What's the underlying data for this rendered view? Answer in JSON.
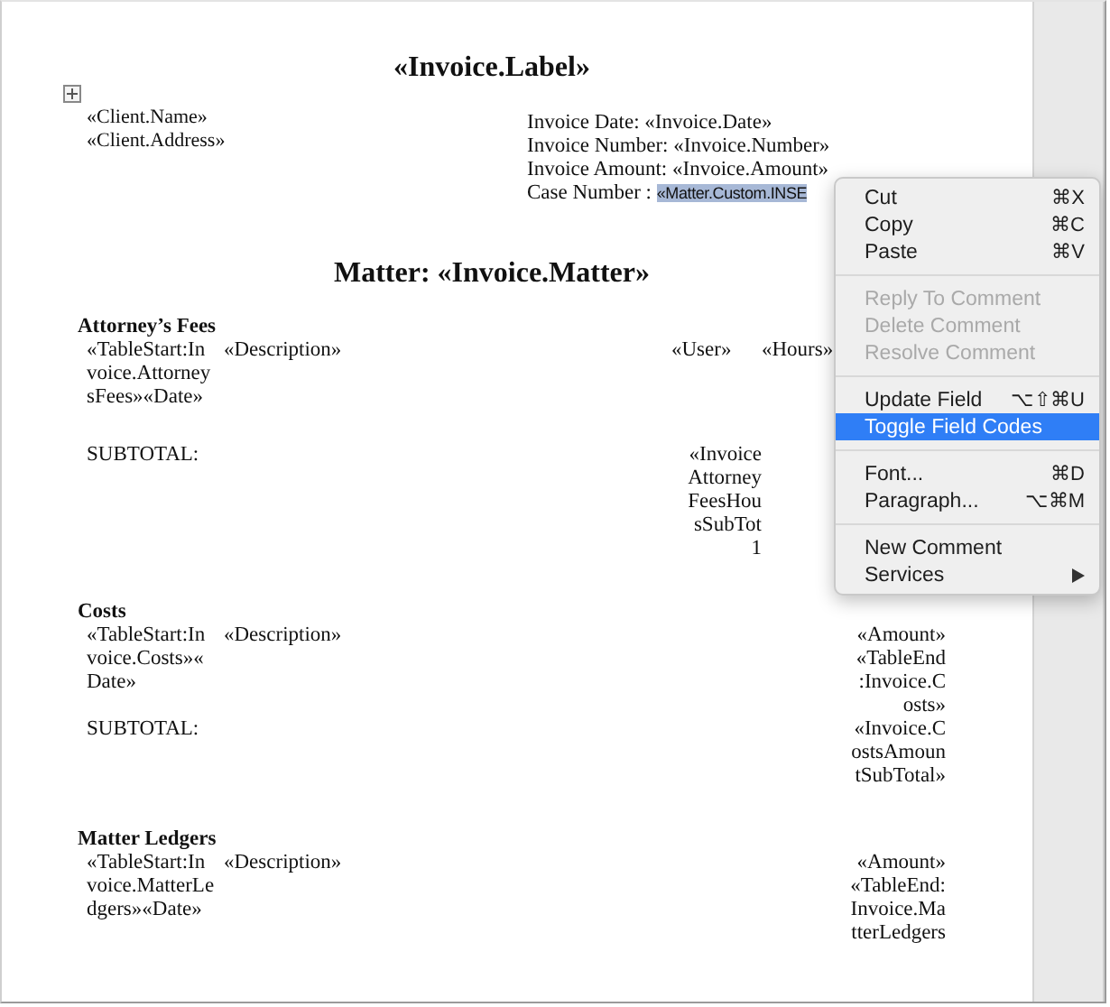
{
  "document": {
    "title": "«Invoice.Label»",
    "client": [
      "«Client.Name»",
      "«Client.Address»"
    ],
    "invoice_info": [
      {
        "label": "Invoice Date: ",
        "value": "«Invoice.Date»",
        "selected": false
      },
      {
        "label": "Invoice Number: ",
        "value": "«Invoice.Number»",
        "selected": false
      },
      {
        "label": "Invoice Amount: ",
        "value": "«Invoice.Amount»",
        "selected": false
      },
      {
        "label": "Case Number : ",
        "value": "«Matter.Custom.INSE",
        "selected": true
      }
    ],
    "matter_heading": "Matter: «Invoice.Matter»",
    "sections": [
      {
        "heading": "Attorney’s Fees",
        "rows": [
          {
            "kind": "entry",
            "date": [
              "«TableStart:In",
              "voice.Attorney",
              "sFees»«Date»"
            ],
            "description": "«Description»",
            "user": "«User»",
            "hours": "«Hours»"
          },
          {
            "kind": "subtotal_mid",
            "label": "SUBTOTAL:",
            "amount": [
              "«Invoice",
              "Attorney",
              "FeesHou",
              "sSubTot",
              "1"
            ]
          }
        ]
      },
      {
        "heading": "Costs",
        "rows": [
          {
            "kind": "entry",
            "date": [
              "«TableStart:In",
              "voice.Costs»«",
              "Date»"
            ],
            "description": "«Description»",
            "amount": [
              "«Amount»",
              "«TableEnd",
              ":Invoice.C",
              "osts»"
            ]
          },
          {
            "kind": "subtotal",
            "label": "SUBTOTAL:",
            "amount": [
              "«Invoice.C",
              "ostsAmoun",
              "tSubTotal»"
            ]
          }
        ]
      },
      {
        "heading": "Matter Ledgers",
        "rows": [
          {
            "kind": "entry",
            "date": [
              "«TableStart:In",
              "voice.MatterLe",
              "dgers»«Date»"
            ],
            "description": "«Description»",
            "amount": [
              "«Amount»",
              "«TableEnd:",
              "Invoice.Ma",
              "tterLedgers"
            ]
          }
        ]
      }
    ]
  },
  "context_menu": [
    [
      {
        "label": "Cut",
        "shortcut": "⌘X",
        "disabled": false,
        "selected": false,
        "submenu": false
      },
      {
        "label": "Copy",
        "shortcut": "⌘C",
        "disabled": false,
        "selected": false,
        "submenu": false
      },
      {
        "label": "Paste",
        "shortcut": "⌘V",
        "disabled": false,
        "selected": false,
        "submenu": false
      }
    ],
    [
      {
        "label": "Reply To Comment",
        "disabled": true,
        "selected": false,
        "submenu": false
      },
      {
        "label": "Delete Comment",
        "disabled": true,
        "selected": false,
        "submenu": false
      },
      {
        "label": "Resolve Comment",
        "disabled": true,
        "selected": false,
        "submenu": false
      }
    ],
    [
      {
        "label": "Update Field",
        "shortcut": "⌥⇧⌘U",
        "disabled": false,
        "selected": false,
        "submenu": false
      },
      {
        "label": "Toggle Field Codes",
        "disabled": false,
        "selected": true,
        "submenu": false
      }
    ],
    [
      {
        "label": "Font...",
        "shortcut": "⌘D",
        "disabled": false,
        "selected": false,
        "submenu": false
      },
      {
        "label": "Paragraph...",
        "shortcut": "⌥⌘M",
        "disabled": false,
        "selected": false,
        "submenu": false
      }
    ],
    [
      {
        "label": "New Comment",
        "disabled": false,
        "selected": false,
        "submenu": false
      },
      {
        "label": "Services",
        "disabled": false,
        "selected": false,
        "submenu": true
      }
    ]
  ]
}
